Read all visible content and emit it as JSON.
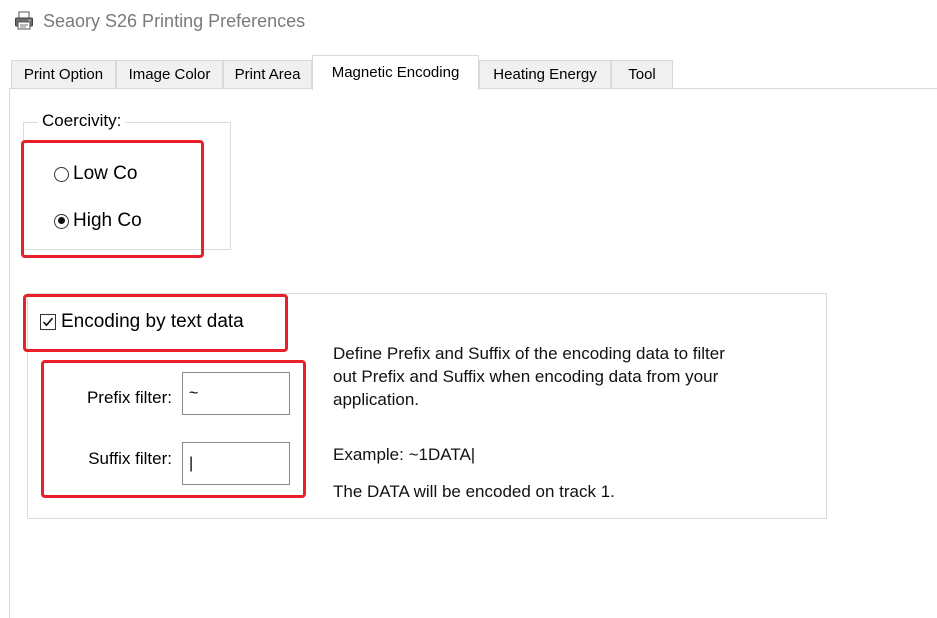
{
  "window": {
    "title": "Seaory S26 Printing Preferences",
    "icon": "printer-icon"
  },
  "tabs": [
    {
      "label": "Print Option",
      "active": false
    },
    {
      "label": "Image Color",
      "active": false
    },
    {
      "label": "Print Area",
      "active": false
    },
    {
      "label": "Magnetic Encoding",
      "active": true
    },
    {
      "label": "Heating Energy",
      "active": false
    },
    {
      "label": "Tool",
      "active": false
    }
  ],
  "coercivity": {
    "title": "Coercivity:",
    "options": [
      {
        "label": "Low Co",
        "selected": false
      },
      {
        "label": "High Co",
        "selected": true
      }
    ]
  },
  "encoding": {
    "checkbox_label": "Encoding by text data",
    "checked": true,
    "prefix_label": "Prefix filter:",
    "prefix_value": "~",
    "suffix_label": "Suffix filter:",
    "suffix_value": "|",
    "description_lines": [
      "Define Prefix and Suffix of the encoding data to filter",
      "out Prefix and Suffix when encoding data from your",
      "application."
    ],
    "example": "Example: ~1DATA|",
    "note": "The DATA will be encoded on track 1."
  },
  "colors": {
    "highlight": "#e8202a",
    "title_text": "#7a7a7a"
  }
}
